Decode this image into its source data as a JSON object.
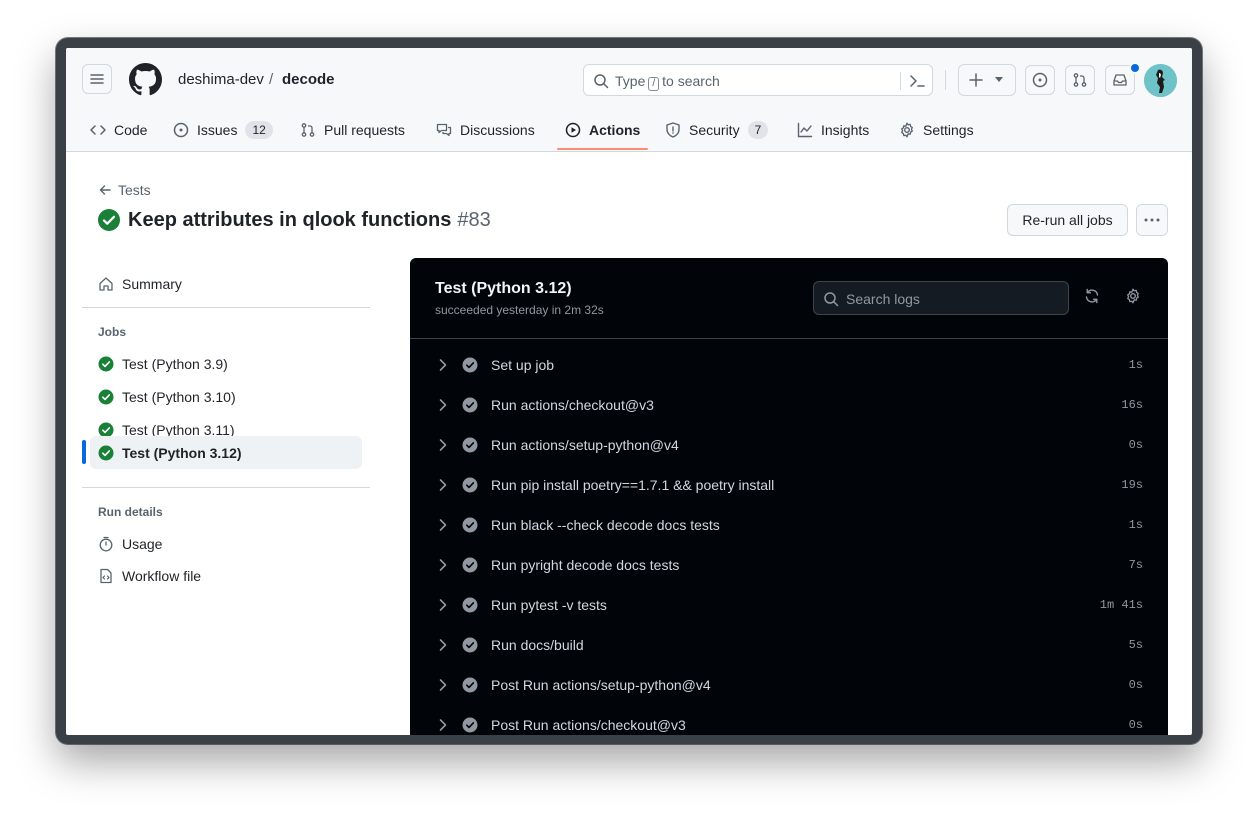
{
  "header": {
    "owner": "deshima-dev",
    "slash": "/",
    "repo": "decode",
    "search_prefix": "Type",
    "search_key": "/",
    "search_suffix": "to search"
  },
  "tabs": [
    {
      "label": "Code",
      "icon": "code-icon"
    },
    {
      "label": "Issues",
      "icon": "issue-opened-icon",
      "count": "12"
    },
    {
      "label": "Pull requests",
      "icon": "git-pull-request-icon"
    },
    {
      "label": "Discussions",
      "icon": "comment-discussion-icon"
    },
    {
      "label": "Actions",
      "icon": "play-icon",
      "active": true
    },
    {
      "label": "Security",
      "icon": "shield-icon",
      "count": "7"
    },
    {
      "label": "Insights",
      "icon": "graph-icon"
    },
    {
      "label": "Settings",
      "icon": "gear-icon"
    }
  ],
  "run": {
    "back_label": "Tests",
    "title": "Keep attributes in qlook functions",
    "number": "#83",
    "rerun_label": "Re-run all jobs"
  },
  "sidebar": {
    "summary": "Summary",
    "jobs_heading": "Jobs",
    "jobs": [
      {
        "label": "Test (Python 3.9)"
      },
      {
        "label": "Test (Python 3.10)"
      },
      {
        "label": "Test (Python 3.11)"
      },
      {
        "label": "Test (Python 3.12)",
        "active": true
      }
    ],
    "details_heading": "Run details",
    "usage": "Usage",
    "workflow_file": "Workflow file"
  },
  "log": {
    "title": "Test (Python 3.12)",
    "subtitle": "succeeded yesterday in 2m 32s",
    "search_placeholder": "Search logs",
    "steps": [
      {
        "name": "Set up job",
        "duration": "1s"
      },
      {
        "name": "Run actions/checkout@v3",
        "duration": "16s"
      },
      {
        "name": "Run actions/setup-python@v4",
        "duration": "0s"
      },
      {
        "name": "Run pip install poetry==1.7.1 && poetry install",
        "duration": "19s"
      },
      {
        "name": "Run black --check decode docs tests",
        "duration": "1s"
      },
      {
        "name": "Run pyright decode docs tests",
        "duration": "7s"
      },
      {
        "name": "Run pytest -v tests",
        "duration": "1m 41s"
      },
      {
        "name": "Run docs/build",
        "duration": "5s"
      },
      {
        "name": "Post Run actions/setup-python@v4",
        "duration": "0s"
      },
      {
        "name": "Post Run actions/checkout@v3",
        "duration": "0s"
      }
    ]
  },
  "colors": {
    "success": "#1a7f37",
    "accent": "#0969da",
    "tab_underline": "#fd8c73",
    "log_bg": "#010409"
  }
}
